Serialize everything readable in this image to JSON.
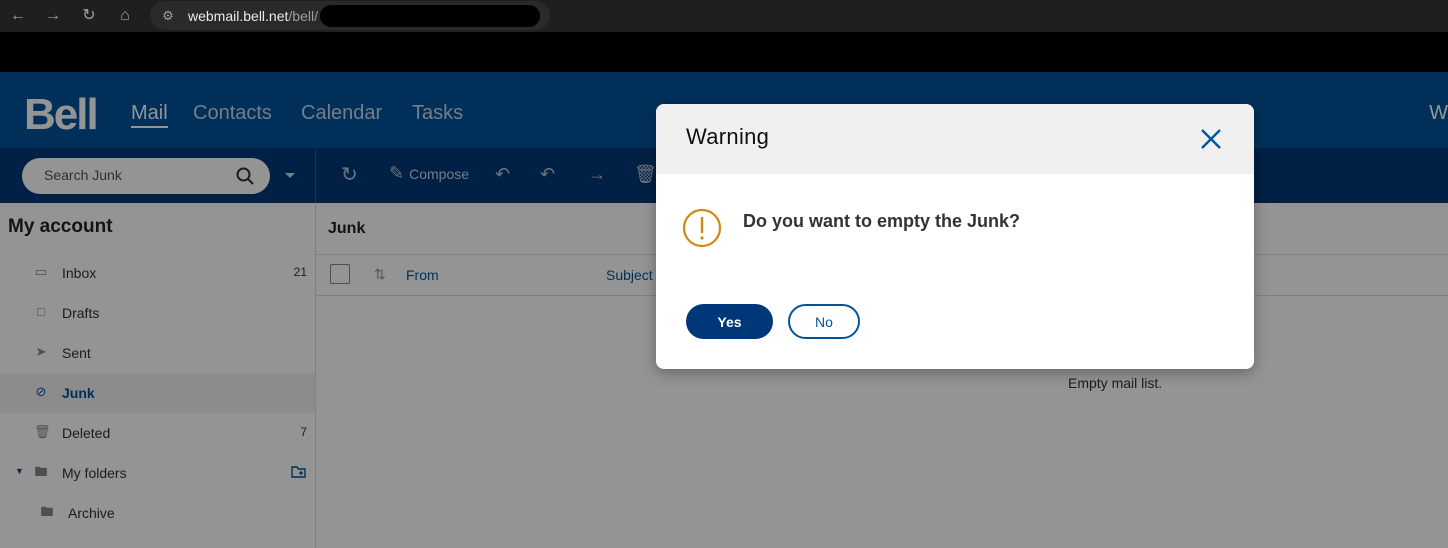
{
  "browser": {
    "url_host": "webmail.bell.net",
    "url_path": "/bell/"
  },
  "header": {
    "logo": "Bell",
    "nav": [
      "Mail",
      "Contacts",
      "Calendar",
      "Tasks"
    ],
    "active_nav": "Mail",
    "right_text": "W"
  },
  "toolbar": {
    "search_placeholder": "Search Junk",
    "compose_label": "Compose"
  },
  "sidebar": {
    "title": "My account",
    "folders": [
      {
        "label": "Inbox",
        "count": "21",
        "icon": "inbox-icon"
      },
      {
        "label": "Drafts",
        "count": "",
        "icon": "drafts-icon"
      },
      {
        "label": "Sent",
        "count": "",
        "icon": "sent-icon"
      },
      {
        "label": "Junk",
        "count": "",
        "icon": "junk-icon",
        "active": true
      },
      {
        "label": "Deleted",
        "count": "7",
        "icon": "trash-icon"
      },
      {
        "label": "My folders",
        "count": "",
        "icon": "folder-icon"
      },
      {
        "label": "Archive",
        "count": "",
        "icon": "folder-icon"
      }
    ]
  },
  "main": {
    "title": "Junk",
    "columns": [
      "From",
      "Subject"
    ],
    "empty_message": "Empty mail list."
  },
  "dialog": {
    "title": "Warning",
    "message": "Do you want to empty the Junk?",
    "yes_label": "Yes",
    "no_label": "No",
    "accent_color": "#d4880f"
  },
  "colors": {
    "brand_blue": "#00549a",
    "toolbar_blue": "#003778"
  }
}
